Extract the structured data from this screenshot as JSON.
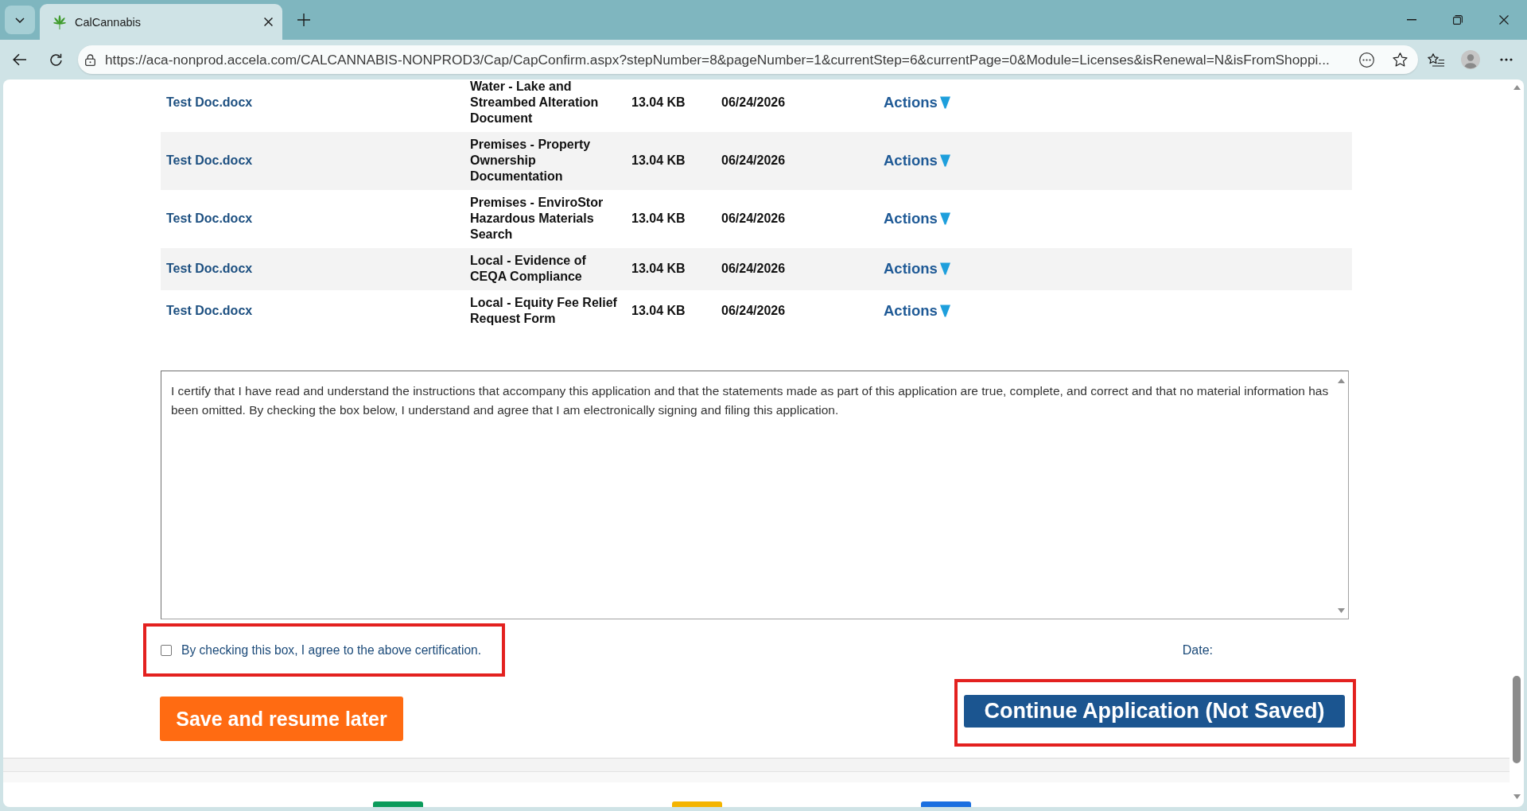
{
  "browser": {
    "tab": {
      "title": "CalCannabis",
      "selected": true
    },
    "address": "https://aca-nonprod.accela.com/CALCANNABIS-NONPROD3/Cap/CapConfirm.aspx?stepNumber=8&pageNumber=1&currentStep=6&currentPage=0&Module=Licenses&isRenewal=N&isFromShoppi..."
  },
  "documents": {
    "rows": [
      {
        "file_name": "Test Doc.docx",
        "document_type": "Water - Lake and Streambed Alteration Document",
        "size": "13.04 KB",
        "date": "06/24/2026",
        "action": "Actions"
      },
      {
        "file_name": "Test Doc.docx",
        "document_type": "Premises - Property Ownership Documentation",
        "size": "13.04 KB",
        "date": "06/24/2026",
        "action": "Actions"
      },
      {
        "file_name": "Test Doc.docx",
        "document_type": "Premises - EnviroStor Hazardous Materials Search",
        "size": "13.04 KB",
        "date": "06/24/2026",
        "action": "Actions"
      },
      {
        "file_name": "Test Doc.docx",
        "document_type": "Local - Evidence of CEQA Compliance",
        "size": "13.04 KB",
        "date": "06/24/2026",
        "action": "Actions"
      },
      {
        "file_name": "Test Doc.docx",
        "document_type": "Local - Equity Fee Relief Request Form",
        "size": "13.04 KB",
        "date": "06/24/2026",
        "action": "Actions"
      }
    ]
  },
  "certification": {
    "text": "I certify that I have read and understand the instructions that accompany this application and that the statements made as part of this application are true, complete, and correct and that no material information has been omitted. By checking the box below, I understand and agree that I am electronically signing and filing this application.",
    "checkbox_label": "By checking this box, I agree to the above certification.",
    "checked": false,
    "highlighted": true,
    "date_label": "Date:"
  },
  "buttons": [
    {
      "kind": "secondary",
      "label": "Save and resume later",
      "highlighted": false
    },
    {
      "kind": "primary",
      "label": "Continue Application (Not Saved)",
      "highlighted": true
    }
  ],
  "footer_links": [
    {
      "color": "#0b9b5b"
    },
    {
      "color": "#f4b400"
    },
    {
      "color": "#1a6fe0"
    }
  ]
}
